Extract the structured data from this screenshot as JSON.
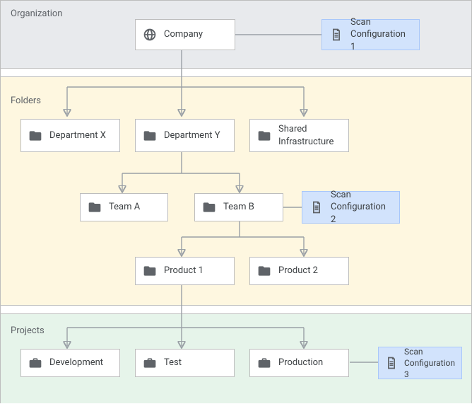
{
  "zones": {
    "org": "Organization",
    "folders": "Folders",
    "projects": "Projects"
  },
  "nodes": {
    "company": "Company",
    "scan1a": "Scan",
    "scan1b": "Configuration 1",
    "deptX": "Department X",
    "deptY": "Department Y",
    "shared1": "Shared",
    "shared2": "Infrastructure",
    "teamA": "Team A",
    "teamB": "Team B",
    "scan2a": "Scan",
    "scan2b": "Configuration 2",
    "product1": "Product 1",
    "product2": "Product 2",
    "dev": "Development",
    "test": "Test",
    "prod": "Production",
    "scan3a": "Scan",
    "scan3b": "Configuration 3"
  }
}
